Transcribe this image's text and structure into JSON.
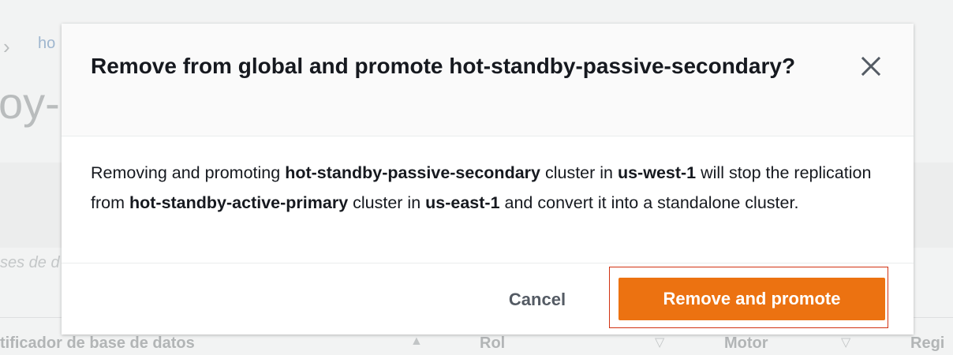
{
  "background": {
    "breadcrumb_partial": "ho",
    "title_partial": "oy-p",
    "filter_placeholder_partial": "ses de d",
    "columns": [
      {
        "label": "tificador de base de datos",
        "sort_icon": "sort-ascending-icon",
        "sort_glyph": "▲"
      },
      {
        "label": "Rol",
        "sort_icon": "sort-descending-icon",
        "sort_glyph": "▽"
      },
      {
        "label": "Motor",
        "sort_icon": "sort-descending-icon",
        "sort_glyph": "▽"
      },
      {
        "label": "Regi"
      }
    ]
  },
  "modal": {
    "title": "Remove from global and promote hot-standby-passive-secondary?",
    "close_icon": "close-icon",
    "body": {
      "segments": [
        {
          "text": "Removing and promoting ",
          "bold": false
        },
        {
          "text": "hot-standby-passive-secondary",
          "bold": true
        },
        {
          "text": " cluster in ",
          "bold": false
        },
        {
          "text": "us-west-1",
          "bold": true
        },
        {
          "text": " will stop the replication from ",
          "bold": false
        },
        {
          "text": "hot-standby-active-primary",
          "bold": true
        },
        {
          "text": " cluster in ",
          "bold": false
        },
        {
          "text": "us-east-1",
          "bold": true
        },
        {
          "text": " and convert it into a standalone cluster.",
          "bold": false
        }
      ]
    },
    "cancel_label": "Cancel",
    "primary_label": "Remove and promote"
  },
  "colors": {
    "primary": "#ec7211",
    "focus_outline": "#d13212",
    "title_text": "#16191f",
    "cancel_text": "#545b64"
  }
}
